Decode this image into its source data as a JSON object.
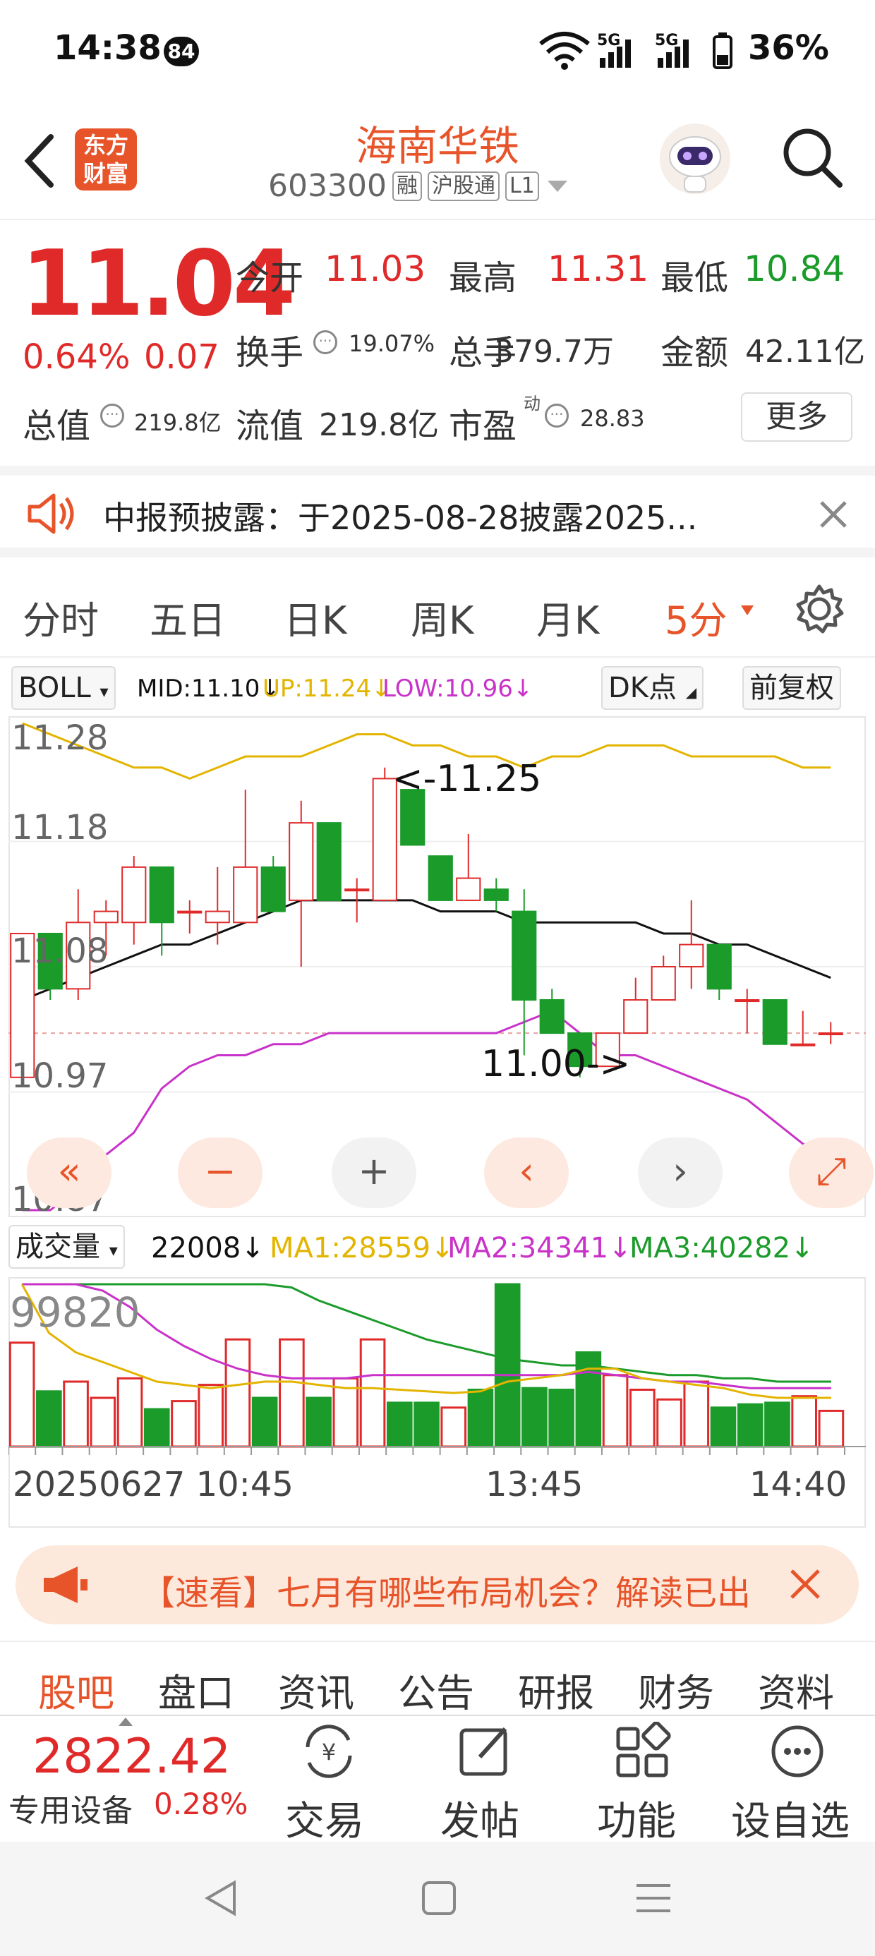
{
  "status": {
    "time": "14:38",
    "badge": "84",
    "battery": "36%",
    "signal1": "5G",
    "signal2": "5G"
  },
  "header": {
    "logo_line1": "东方",
    "logo_line2": "财富",
    "name": "海南华铁",
    "code": "603300",
    "tag_margin": "融",
    "tag_connect": "沪股通",
    "tag_level": "L1"
  },
  "quote": {
    "price": "11.04",
    "change_pct": "0.64%",
    "change_abs": "0.07",
    "open_label": "今开",
    "open": "11.03",
    "high_label": "最高",
    "high": "11.31",
    "low_label": "最低",
    "low": "10.84",
    "turnover_label": "换手",
    "turnover": "19.07%",
    "volume_label": "总手",
    "volume": "379.7万",
    "amount_label": "金额",
    "amount": "42.11亿",
    "mcap_label": "总值",
    "mcap": "219.8亿",
    "float_label": "流值",
    "float": "219.8亿",
    "pe_label": "市盈",
    "pe_sup": "动",
    "pe": "28.83",
    "more": "更多"
  },
  "notice": {
    "text": "中报预披露：于2025-08-28披露2025..."
  },
  "period_tabs": [
    "分时",
    "五日",
    "日K",
    "周K",
    "月K",
    "5分"
  ],
  "period_active": "5分",
  "indicator": {
    "name": "BOLL",
    "mid": "MID:11.10↓",
    "up": "UP:11.24↓",
    "low": "LOW:10.96↓",
    "dk": "DK点",
    "adjust": "前复权"
  },
  "chart_data": {
    "type": "candlestick",
    "y_ticks": [
      "11.28",
      "11.18",
      "11.08",
      "10.97",
      "10.87"
    ],
    "ylim": [
      10.86,
      11.3
    ],
    "annotation_high": "<-11.25",
    "annotation_low": "11.00->",
    "candles": [
      {
        "o": 10.98,
        "c": 11.11,
        "h": 11.11,
        "l": 10.98
      },
      {
        "o": 11.11,
        "c": 11.06,
        "h": 11.11,
        "l": 11.05
      },
      {
        "o": 11.06,
        "c": 11.12,
        "h": 11.15,
        "l": 11.05
      },
      {
        "o": 11.12,
        "c": 11.13,
        "h": 11.14,
        "l": 11.09
      },
      {
        "o": 11.12,
        "c": 11.17,
        "h": 11.18,
        "l": 11.1
      },
      {
        "o": 11.17,
        "c": 11.12,
        "h": 11.17,
        "l": 11.09
      },
      {
        "o": 11.13,
        "c": 11.13,
        "h": 11.14,
        "l": 11.11
      },
      {
        "o": 11.12,
        "c": 11.13,
        "h": 11.17,
        "l": 11.1
      },
      {
        "o": 11.12,
        "c": 11.17,
        "h": 11.24,
        "l": 11.12
      },
      {
        "o": 11.17,
        "c": 11.13,
        "h": 11.18,
        "l": 11.13
      },
      {
        "o": 11.14,
        "c": 11.21,
        "h": 11.23,
        "l": 11.08
      },
      {
        "o": 11.21,
        "c": 11.14,
        "h": 11.21,
        "l": 11.14
      },
      {
        "o": 11.15,
        "c": 11.15,
        "h": 11.16,
        "l": 11.12
      },
      {
        "o": 11.14,
        "c": 11.25,
        "h": 11.26,
        "l": 11.14
      },
      {
        "o": 11.24,
        "c": 11.19,
        "h": 11.24,
        "l": 11.19
      },
      {
        "o": 11.18,
        "c": 11.14,
        "h": 11.18,
        "l": 11.14
      },
      {
        "o": 11.14,
        "c": 11.16,
        "h": 11.2,
        "l": 11.14
      },
      {
        "o": 11.15,
        "c": 11.14,
        "h": 11.16,
        "l": 11.13
      },
      {
        "o": 11.13,
        "c": 11.05,
        "h": 11.15,
        "l": 11.0
      },
      {
        "o": 11.05,
        "c": 11.02,
        "h": 11.06,
        "l": 11.02
      },
      {
        "o": 11.02,
        "c": 10.99,
        "h": 11.02,
        "l": 10.98
      },
      {
        "o": 10.99,
        "c": 11.02,
        "h": 11.02,
        "l": 10.99
      },
      {
        "o": 11.02,
        "c": 11.05,
        "h": 11.07,
        "l": 11.02
      },
      {
        "o": 11.05,
        "c": 11.08,
        "h": 11.09,
        "l": 11.05
      },
      {
        "o": 11.08,
        "c": 11.1,
        "h": 11.14,
        "l": 11.06
      },
      {
        "o": 11.1,
        "c": 11.06,
        "h": 11.1,
        "l": 11.05
      },
      {
        "o": 11.05,
        "c": 11.05,
        "h": 11.06,
        "l": 11.02
      },
      {
        "o": 11.05,
        "c": 11.01,
        "h": 11.05,
        "l": 11.01
      },
      {
        "o": 11.01,
        "c": 11.01,
        "h": 11.04,
        "l": 11.01
      },
      {
        "o": 11.02,
        "c": 11.02,
        "h": 11.03,
        "l": 11.01
      }
    ],
    "mid": [
      11.05,
      11.06,
      11.07,
      11.08,
      11.09,
      11.1,
      11.1,
      11.11,
      11.12,
      11.13,
      11.14,
      11.14,
      11.14,
      11.14,
      11.14,
      11.13,
      11.13,
      11.13,
      11.12,
      11.12,
      11.12,
      11.12,
      11.12,
      11.11,
      11.11,
      11.1,
      11.1,
      11.09,
      11.08,
      11.07
    ],
    "upper": [
      11.3,
      11.29,
      11.28,
      11.27,
      11.26,
      11.26,
      11.25,
      11.26,
      11.27,
      11.27,
      11.27,
      11.28,
      11.29,
      11.29,
      11.28,
      11.28,
      11.27,
      11.27,
      11.26,
      11.27,
      11.27,
      11.28,
      11.28,
      11.28,
      11.27,
      11.27,
      11.27,
      11.27,
      11.26,
      11.26
    ],
    "lower": [
      10.86,
      10.86,
      10.88,
      10.91,
      10.93,
      10.97,
      10.99,
      11.0,
      11.0,
      11.01,
      11.01,
      11.02,
      11.02,
      11.02,
      11.02,
      11.02,
      11.02,
      11.02,
      11.03,
      11.04,
      11.02,
      11.0,
      11.0,
      10.99,
      10.98,
      10.97,
      10.96,
      10.94,
      10.92,
      10.91
    ]
  },
  "controls": [
    "«",
    "−",
    "+",
    "‹",
    "›",
    "⤢"
  ],
  "volume": {
    "label": "成交量",
    "current": "22008↓",
    "ma1": "MA1:28559↓",
    "ma2": "MA2:34341↓",
    "ma3": "MA3:40282↓",
    "max_label": "99820",
    "bars": [
      64,
      34,
      40,
      30,
      42,
      23,
      28,
      38,
      66,
      30,
      66,
      30,
      42,
      66,
      27,
      27,
      24,
      35,
      100,
      36,
      35,
      58,
      44,
      35,
      29,
      40,
      24,
      26,
      27,
      31,
      22
    ],
    "bar_up": [
      true,
      false,
      true,
      true,
      true,
      false,
      true,
      true,
      true,
      false,
      true,
      false,
      true,
      true,
      false,
      false,
      true,
      false,
      false,
      false,
      false,
      false,
      true,
      true,
      true,
      true,
      false,
      false,
      false,
      true,
      true
    ],
    "time_start": "20250627 10:45",
    "time_mid": "13:45",
    "time_end": "14:40"
  },
  "promo": {
    "text": "【速看】七月有哪些布局机会？解读已出"
  },
  "bottom_tabs": [
    "股吧",
    "盘口",
    "资讯",
    "公告",
    "研报",
    "财务",
    "资料"
  ],
  "bottom_tab_active": "股吧",
  "index": {
    "value": "2822.42",
    "label": "专用设备",
    "pct": "0.28%"
  },
  "actions": [
    "交易",
    "发帖",
    "功能",
    "设自选"
  ],
  "colors": {
    "up": "#e02a2a",
    "down": "#1b9b2a",
    "accent": "#e8542a",
    "mid": "#111111",
    "upper": "#e3b400",
    "lower": "#c932c9"
  }
}
